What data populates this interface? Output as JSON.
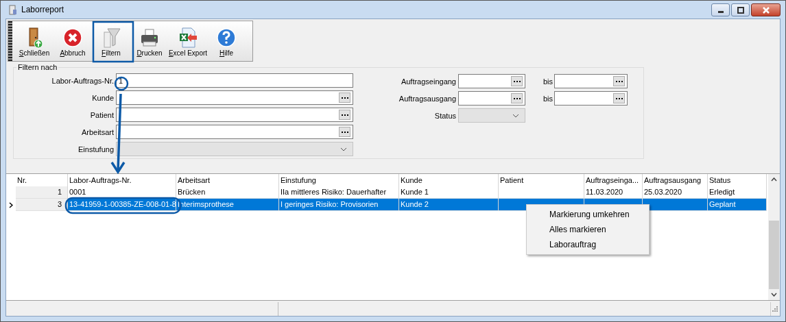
{
  "window": {
    "title": "Laborreport"
  },
  "toolbar": [
    {
      "label": "Schließen",
      "kind": "door"
    },
    {
      "label": "Abbruch",
      "kind": "cancel"
    },
    {
      "label": "Filtern",
      "kind": "filter"
    },
    {
      "label": "Drucken",
      "kind": "printer"
    },
    {
      "label": "Excel Export",
      "kind": "excel"
    },
    {
      "label": "Hilfe",
      "kind": "help"
    }
  ],
  "filter": {
    "title": "Filtern nach",
    "left_fields": [
      {
        "label": "Labor-Auftrags-Nr.",
        "kind": "text",
        "value": "1"
      },
      {
        "label": "Kunde",
        "kind": "lookup"
      },
      {
        "label": "Patient",
        "kind": "lookup"
      },
      {
        "label": "Arbeitsart",
        "kind": "lookup"
      },
      {
        "label": "Einstufung",
        "kind": "combo",
        "disabled": true
      }
    ],
    "right_fields": [
      {
        "label": "Auftragseingang",
        "kind": "range",
        "to_label": "bis"
      },
      {
        "label": "Auftragsausgang",
        "kind": "range",
        "to_label": "bis"
      },
      {
        "label": "Status",
        "kind": "combo",
        "disabled": true
      }
    ]
  },
  "grid": {
    "columns": [
      "Nr.",
      "Labor-Auftrags-Nr.",
      "Arbeitsart",
      "Einstufung",
      "Kunde",
      "Patient",
      "Auftragseinga...",
      "Auftragsausgang",
      "Status"
    ],
    "rows": [
      {
        "selected": false,
        "current": false,
        "cells": [
          "1",
          "0001",
          "Brücken",
          "IIa mittleres Risiko: Dauerhafter",
          "Kunde 1",
          "",
          "11.03.2020",
          "25.03.2020",
          "Erledigt"
        ]
      },
      {
        "selected": true,
        "current": true,
        "cells": [
          "3",
          "13-41959-1-00385-ZE-008-01-8",
          "Interimsprothese",
          "I geringes Risiko: Provisorien",
          "Kunde 2",
          "",
          "",
          "",
          "Geplant"
        ]
      }
    ]
  },
  "context_menu": {
    "items": [
      "Markierung umkehren",
      "Alles markieren",
      "Laborauftrag"
    ]
  }
}
